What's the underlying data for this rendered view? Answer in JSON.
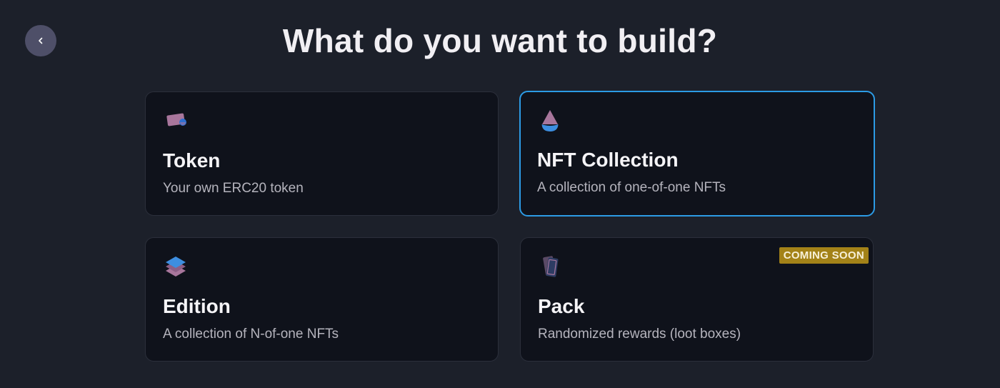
{
  "header": {
    "title": "What do you want to build?",
    "back_icon": "chevron-left-icon"
  },
  "cards": [
    {
      "id": "token",
      "title": "Token",
      "description": "Your own ERC20 token",
      "icon": "token-card-icon",
      "selected": false
    },
    {
      "id": "nft-collection",
      "title": "NFT Collection",
      "description": "A collection of one-of-one NFTs",
      "icon": "ethereum-drop-icon",
      "selected": true
    },
    {
      "id": "edition",
      "title": "Edition",
      "description": "A collection of N-of-one NFTs",
      "icon": "layers-icon",
      "selected": false
    },
    {
      "id": "pack",
      "title": "Pack",
      "description": "Randomized rewards (loot boxes)",
      "icon": "card-pack-icon",
      "badge": "COMING SOON",
      "selected": false
    }
  ],
  "colors": {
    "background": "#1c202a",
    "card": "#0f121b",
    "selected_border": "#2c9be5",
    "badge": "#a38218"
  }
}
